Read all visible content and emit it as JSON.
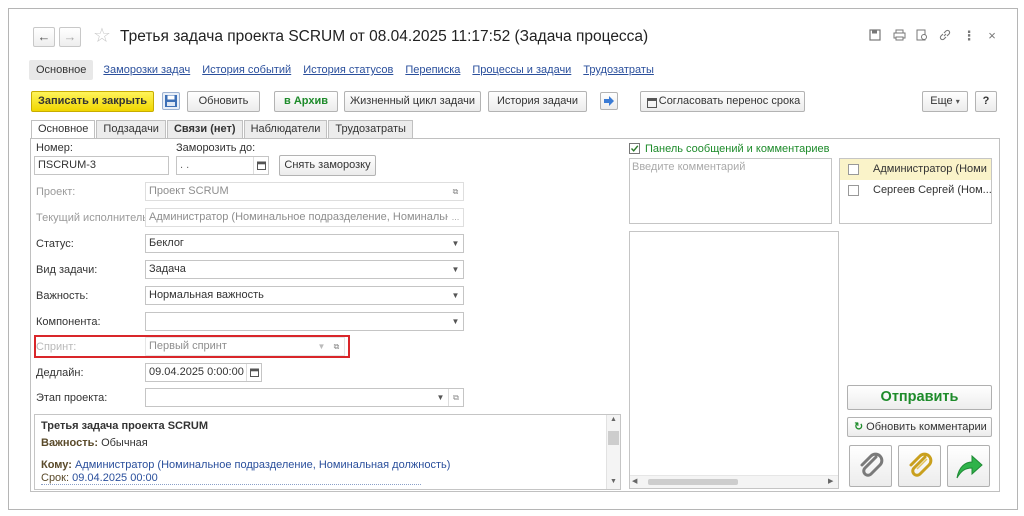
{
  "window": {
    "title": "Третья задача проекта SCRUM от 08.04.2025 11:17:52 (Задача процесса)"
  },
  "sections": [
    {
      "label": "Основное"
    },
    {
      "label": "Заморозки задач"
    },
    {
      "label": "История событий"
    },
    {
      "label": "История статусов"
    },
    {
      "label": "Переписка"
    },
    {
      "label": "Процессы и задачи"
    },
    {
      "label": "Трудозатраты"
    }
  ],
  "toolbar": {
    "save_close": "Записать и закрыть",
    "refresh": "Обновить",
    "archive": "в Архив",
    "lifecycle": "Жизненный цикл задачи",
    "history": "История задачи",
    "agree_transfer": "Согласовать перенос срока",
    "more": "Еще",
    "help": "?"
  },
  "tabs": [
    {
      "label": "Основное"
    },
    {
      "label": "Подзадачи"
    },
    {
      "label": "Связи (нет)"
    },
    {
      "label": "Наблюдатели"
    },
    {
      "label": "Трудозатраты"
    }
  ],
  "form": {
    "number_label": "Номер:",
    "number_value": "ПSCRUM-3",
    "freeze_label": "Заморозить до:",
    "freeze_value": " .  .",
    "unfreeze_button": "Снять заморозку",
    "project_label": "Проект:",
    "project_value": "Проект SCRUM",
    "executor_label": "Текущий исполнитель:",
    "executor_value": "Администратор (Номинальное подразделение, Номинальная д",
    "status_label": "Статус:",
    "status_value": "Беклог",
    "type_label": "Вид задачи:",
    "type_value": "Задача",
    "priority_label": "Важность:",
    "priority_value": "Нормальная важность",
    "component_label": "Компонента:",
    "component_value": "",
    "sprint_label": "Спринт:",
    "sprint_value": "Первый спринт",
    "deadline_label": "Дедлайн:",
    "deadline_value": "09.04.2025  0:00:00",
    "stage_label": "Этап проекта:",
    "stage_value": ""
  },
  "description": {
    "title": "Третья задача проекта SCRUM",
    "priority_label": "Важность:",
    "priority_value": "Обычная",
    "to_label": "Кому:",
    "to_value": "Администратор (Номинальное подразделение, Номинальная должность)",
    "due_label": "Срок:",
    "due_value": "09.04.2025 00:00"
  },
  "comments": {
    "panel_label": "Панель сообщений и комментариев",
    "placeholder": "Введите комментарий",
    "recipients": [
      {
        "name": "Администратор (Номи",
        "checked": false
      },
      {
        "name": "Сергеев Сергей (Ном...",
        "checked": false
      }
    ],
    "send_button": "Отправить",
    "refresh_button": "Обновить комментарии"
  },
  "colors": {
    "accent_yellow": "#f5e21a",
    "link_blue": "#2a4f9c",
    "green": "#1d8b2a",
    "highlight_red": "#d9262a"
  }
}
